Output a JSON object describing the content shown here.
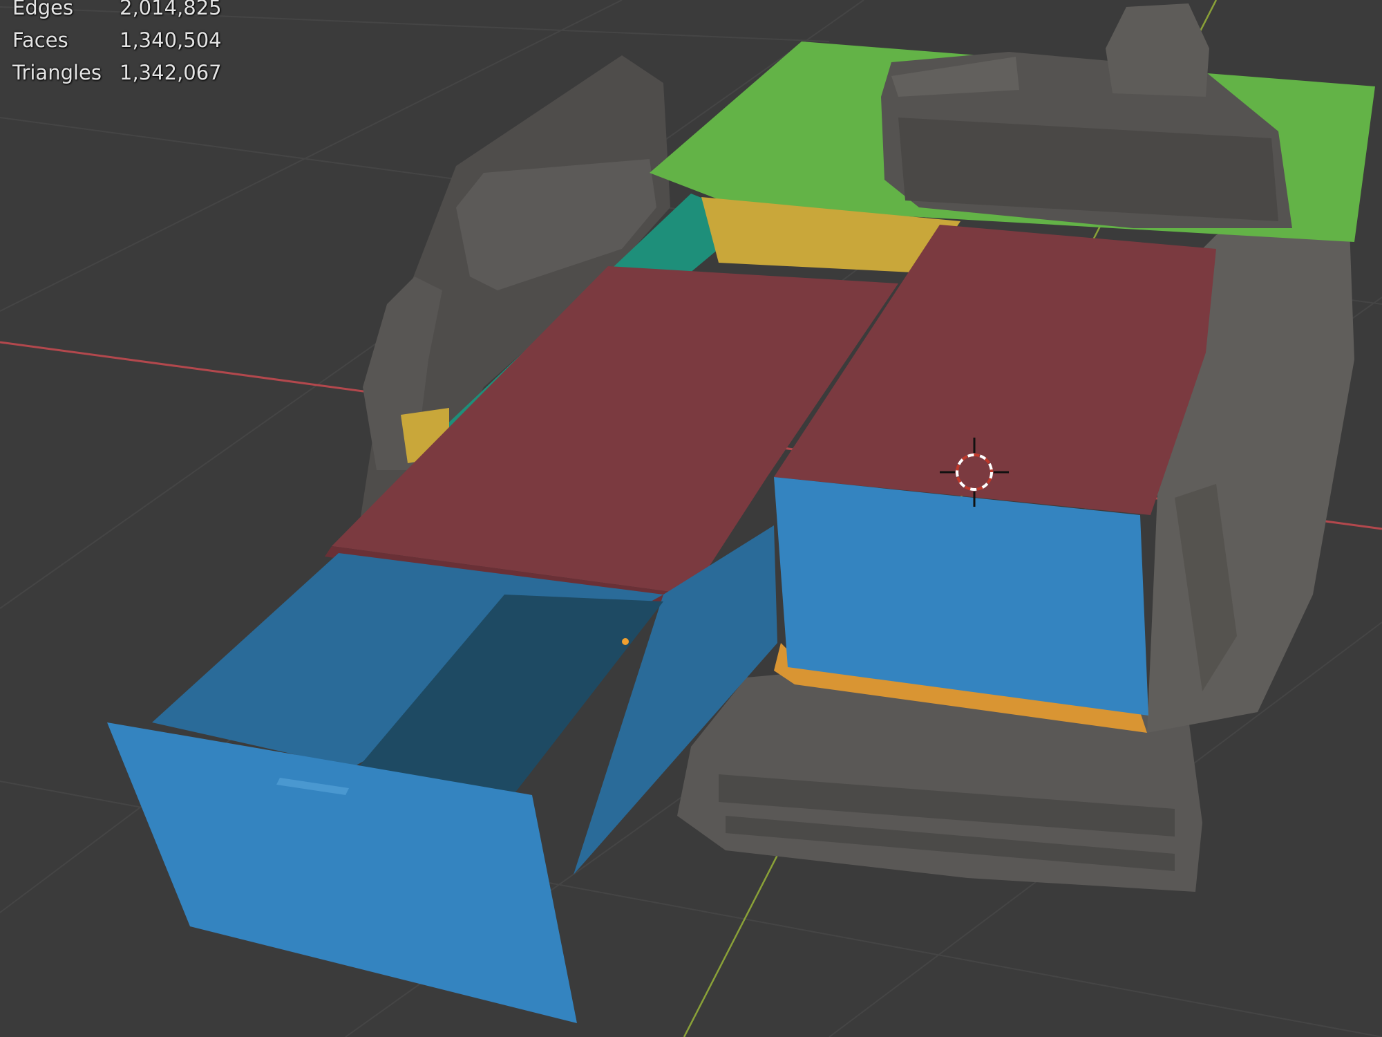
{
  "viewport": {
    "background": "#3b3b3b",
    "statistics": [
      {
        "label": "Edges",
        "value": "2,014,825"
      },
      {
        "label": "Faces",
        "value": "1,340,504"
      },
      {
        "label": "Triangles",
        "value": "1,342,067"
      }
    ]
  },
  "colors": {
    "grid_line": "#454545",
    "x_axis": "#b3484d",
    "y_axis": "#8aa138",
    "scan_mesh": "#5a5856",
    "green_panel": "#63b347",
    "yellow_panel": "#c9a73a",
    "teal_rail": "#1e8f7a",
    "red_lid": "#7b3a40",
    "blue_drawer": "#3484c0",
    "orange_base": "#d99533",
    "cursor": "#ffffff"
  },
  "icons": {
    "cursor": "3d-cursor-icon",
    "origin": "origin-dot-icon"
  }
}
